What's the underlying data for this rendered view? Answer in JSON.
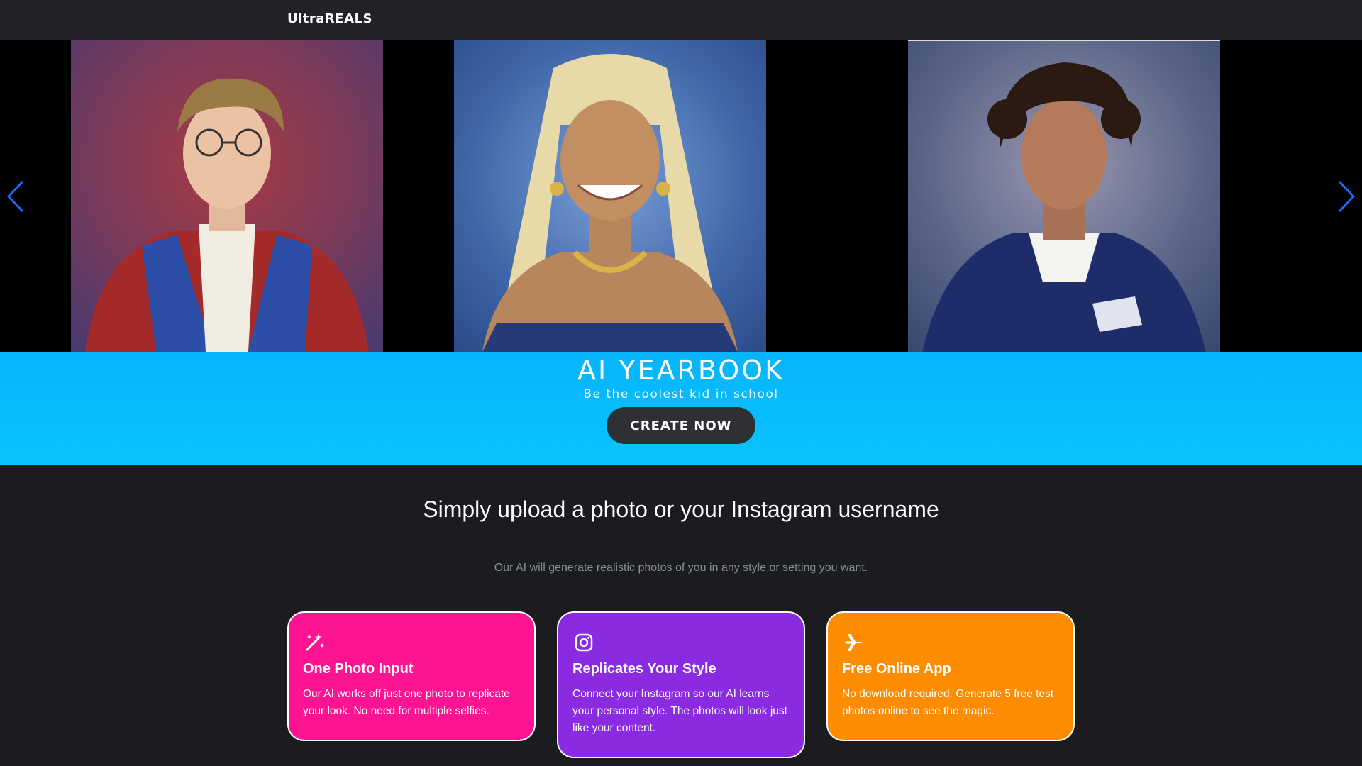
{
  "header": {
    "logo": "UltraREALS"
  },
  "carousel": {
    "slides": [
      {
        "alt": "Yearbook portrait of young man with glasses and red cardigan"
      },
      {
        "alt": "Yearbook portrait of smiling woman with blonde braids and gold jewelry"
      },
      {
        "alt": "Yearbook portrait of teen with curly hair in navy jacket"
      }
    ],
    "prev_icon": "chevron-left-icon",
    "next_icon": "chevron-right-icon"
  },
  "hero": {
    "title": "AI YEARBOOK",
    "subtitle": "Be the coolest kid in school",
    "cta": "CREATE NOW"
  },
  "features": {
    "title": "Simply upload a photo or your Instagram username",
    "subtitle": "Our AI will generate realistic photos of you in any style or setting you want.",
    "cards": [
      {
        "icon": "magic-wand-icon",
        "title": "One Photo Input",
        "text": "Our AI works off just one photo to replicate your look. No need for multiple selfies.",
        "color": "#fe1493"
      },
      {
        "icon": "instagram-icon",
        "title": "Replicates Your Style",
        "text": "Connect your Instagram so our AI learns your personal style. The photos will look just like your content.",
        "color": "#8a2be2"
      },
      {
        "icon": "airplane-icon",
        "title": "Free Online App",
        "text": "No download required. Generate 5 free test photos online to see the magic.",
        "color": "#fe8c00"
      }
    ]
  },
  "colors": {
    "hero": "#06b4fb",
    "arrow": "#1a6cff",
    "background": "#1b1c1f"
  }
}
